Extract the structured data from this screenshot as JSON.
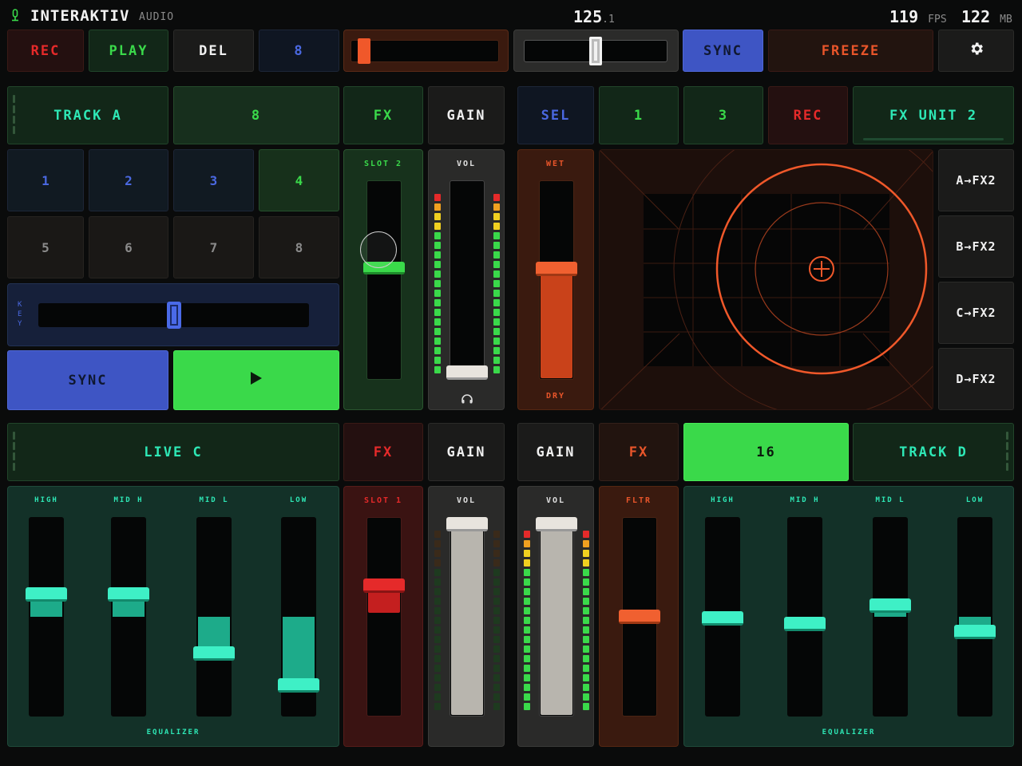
{
  "header": {
    "app_name": "INTERAKTIV",
    "app_sub": "AUDIO",
    "bpm_main": "125",
    "bpm_frac": ".1",
    "fps_value": "119",
    "fps_label": "FPS",
    "mem_value": "122",
    "mem_label": "MB"
  },
  "toolbar": {
    "rec": "REC",
    "play": "PLAY",
    "del": "DEL",
    "count": "8",
    "sync": "SYNC",
    "freeze": "FREEZE",
    "slider_left_value": 0.05,
    "slider_mid_value": 0.5
  },
  "deck_a": {
    "track_label": "TRACK A",
    "beat_count": "8",
    "fx_label": "FX",
    "gain_label": "GAIN",
    "pads": [
      "1",
      "2",
      "3",
      "4",
      "5",
      "6",
      "7",
      "8"
    ],
    "key_label": "K E Y",
    "key_value": 0.5,
    "sync_label": "SYNC",
    "play_icon": "play-icon",
    "slot_label": "SLOT 2",
    "slot_value": 0.56,
    "vol_label": "VOL",
    "vol_value": 0.0
  },
  "fx_unit": {
    "sel_label": "SEL",
    "btn1": "1",
    "btn2": "3",
    "rec_label": "REC",
    "title": "FX UNIT 2",
    "wet_label": "WET",
    "dry_label": "DRY",
    "wet_value": 0.56,
    "routes": [
      "A→FX2",
      "B→FX2",
      "C→FX2",
      "D→FX2"
    ]
  },
  "deck_c": {
    "track_label": "LIVE C",
    "fx_label": "FX",
    "gain_label": "GAIN",
    "eq_labels": [
      "HIGH",
      "MID H",
      "MID L",
      "LOW"
    ],
    "eq_values": [
      0.62,
      0.62,
      0.3,
      0.13
    ],
    "eq_title": "EQUALIZER",
    "slot_label": "SLOT 1",
    "slot_value": 0.67,
    "vol_label": "VOL",
    "vol_value": 1.0
  },
  "deck_d": {
    "track_label": "TRACK D",
    "gain_label": "GAIN",
    "fx_label": "FX",
    "beat_count": "16",
    "vol_label": "VOL",
    "vol_value": 1.0,
    "fltr_label": "FLTR",
    "fltr_value": 0.5,
    "eq_labels": [
      "HIGH",
      "MID H",
      "MID L",
      "LOW"
    ],
    "eq_values": [
      0.49,
      0.46,
      0.56,
      0.42
    ],
    "eq_title": "EQUALIZER"
  },
  "colors": {
    "green": "#3ad94a",
    "teal": "#2ee8b6",
    "red": "#e02a2a",
    "orange": "#e8552a",
    "blue": "#3e55c4"
  }
}
